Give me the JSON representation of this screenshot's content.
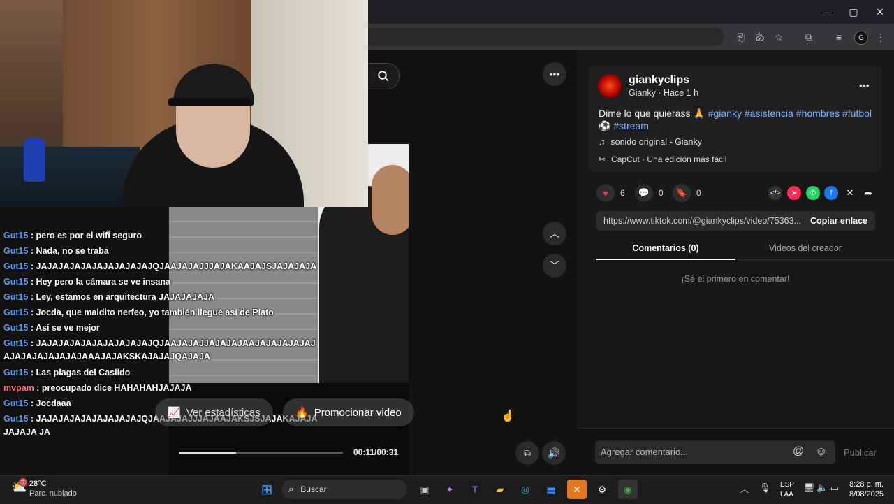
{
  "window": {
    "minimize": "—",
    "maximize": "▢",
    "close": "✕"
  },
  "chat": {
    "messages": [
      {
        "user": "Gut15",
        "text": " : pero es por el wifi seguro"
      },
      {
        "user": "Gut15",
        "text": " : Nada, no se traba"
      },
      {
        "user": "Gut15",
        "text": " : JAJAJAJAJAJAJAJAJAJAJQJAAJAJAJJJAJAKAAJAJSJAJAJAJA"
      },
      {
        "user": "Gut15",
        "text": " : Hey pero la cámara se ve insana"
      },
      {
        "user": "Gut15",
        "text": " : Ley, estamos en arquitectura JAJAJAJAJA"
      },
      {
        "user": "Gut15",
        "text": " : Jocda, que maldito nerfeo, yo también llegué así de Plato"
      },
      {
        "user": "Gut15",
        "text": " : Así se ve mejor"
      },
      {
        "user": "Gut15",
        "text": " : JAJAJAJAJAJAJAJAJAJAJQJAAJAJAJJAJAJAJAAJAJAJAJAJAJAJAJAJAJAJAJAJAAAJAJAKSKAJAJAJQAJAJA"
      },
      {
        "user": "Gut15",
        "text": " : Las plagas del Casildo"
      },
      {
        "user": "mvpam",
        "text": " : preocupado dice HAHAHAHJAJAJA"
      },
      {
        "user": "Gut15",
        "text": " : Jocdaaa"
      },
      {
        "user": "Gut15",
        "text": " : JAJAJAJAJAJAJAJAJAJQJAAJAJAJJJAJAAJAKSJSJAJAKAJAJAJAJAJA JA"
      }
    ]
  },
  "player": {
    "stats_label": "Ver estadísticas",
    "promote_label": "Promocionar video",
    "time": "00:11/00:31",
    "progress": 0.35
  },
  "post": {
    "username": "giankyclips",
    "meta": "Gianky · Hace 1 h",
    "caption_prefix": "Dime lo que quierass 🙏",
    "tags": [
      "#gianky",
      "#asistencia",
      "#hombres",
      "#futbol",
      "#stream"
    ],
    "football_emoji": "⚽",
    "sound": "sonido original - Gianky",
    "capcut": "CapCut · Una edición más fácil",
    "likes": "6",
    "comments": "0",
    "saves": "0",
    "link": "https://www.tiktok.com/@giankyclips/video/75363...",
    "copy_link": "Copiar enlace",
    "tab_comments": "Comentarios (0)",
    "tab_videos": "Videos del creador",
    "empty": "¡Sé el primero en comentar!",
    "comment_placeholder": "Agregar comentario...",
    "publish": "Publicar"
  },
  "taskbar": {
    "temp": "28°C",
    "weather": "Parc. nublado",
    "weather_badge": "3",
    "search": "Buscar",
    "lang1": "ESP",
    "lang2": "LAA",
    "time": "8:28 p. m.",
    "date": "8/08/2025"
  },
  "colors": {
    "accent_blue": "#7fb1ff",
    "like_red": "#fe2c55",
    "user_blue": "#5b9cf0",
    "user_pink": "#ff6f91"
  }
}
